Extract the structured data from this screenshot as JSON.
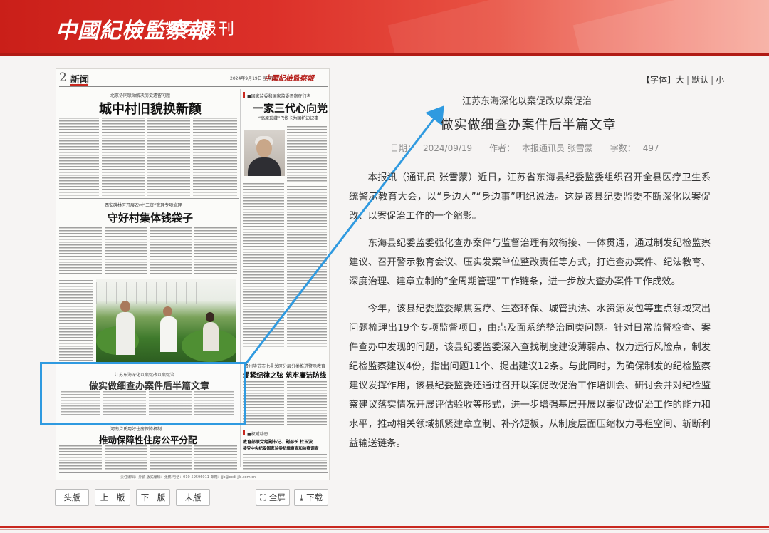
{
  "header": {
    "brand": "中國紀檢監察報",
    "subtitle": "数字报刊"
  },
  "paper": {
    "page_number": "2",
    "section": "新闻",
    "date": "2024年9月19日 星期四",
    "logo": "中國紀檢監察報",
    "story1": {
      "kicker": "北京协同联动解决历史遗留问题",
      "headline": "城中村旧貌换新颜"
    },
    "story2": {
      "kicker": "■国家监委和国家监委督察在行者",
      "headline": "一家三代心向党",
      "subhead": "“高原珍藏”巴依卡为国护边记事"
    },
    "story3": {
      "kicker": "西安碑林区开展农村“三资”管理专项治理",
      "headline": "守好村集体钱袋子"
    },
    "story4": {
      "kicker": "江苏东海深化以案促改以案促治",
      "headline": "做实做细查办案件后半篇文章"
    },
    "story5": {
      "kicker": "贵州毕节市七星关区分层分类推进警示教育",
      "headline": "绷紧纪律之弦 筑牢廉洁防线"
    },
    "story6": {
      "kicker": "河南卢氏用好住房保障机制",
      "headline": "推动保障性住房公平分配"
    },
    "story7": {
      "kicker": "■权威动态",
      "headline_line1": "教育部原党组副书记、副部长 杜玉波",
      "headline_line2": "接受中央纪委国家监委纪律审查和监察调查"
    },
    "footer_line": "责任编辑：孙毓  版式编辑：张鹏  电话：010-59596011  邮箱：jjb@ccdi-jjb.com.cn"
  },
  "toolbar": {
    "font_label": "【字体】",
    "font_large": "大",
    "font_default": "默认",
    "font_small": "小"
  },
  "article": {
    "kicker": "江苏东海深化以案促改以案促治",
    "title": "做实做细查办案件后半篇文章",
    "meta": {
      "date_label": "日期：",
      "date": "2024/09/19",
      "author_label": "作者：",
      "author": "本报通讯员 张雪蒙",
      "words_label": "字数：",
      "words": "497"
    },
    "paragraphs": [
      "本报讯（通讯员 张雪蒙）近日，江苏省东海县纪委监委组织召开全县医疗卫生系统警示教育大会，以“身边人”“身边事”明纪说法。这是该县纪委监委不断深化以案促改、以案促治工作的一个缩影。",
      "东海县纪委监委强化查办案件与监督治理有效衔接、一体贯通，通过制发纪检监察建议、召开警示教育会议、压实发案单位整改责任等方式，打造查办案件、纪法教育、深度治理、建章立制的“全周期管理”工作链条，进一步放大查办案件工作成效。",
      "今年，该县纪委监委聚焦医疗、生态环保、城管执法、水资源发包等重点领域突出问题梳理出19个专项监督项目，由点及面系统整治同类问题。针对日常监督检查、案件查办中发现的问题，该县纪委监委深入查找制度建设薄弱点、权力运行风险点，制发纪检监察建议4份，指出问题11个、提出建议12条。与此同时，为确保制发的纪检监察建议发挥作用，该县纪委监委还通过召开以案促改促治工作培训会、研讨会并对纪检监察建议落实情况开展评估验收等形式，进一步增强基层开展以案促改促治工作的能力和水平，推动相关领域抓紧建章立制、补齐短板，从制度层面压缩权力寻租空间、斩断利益输送链条。"
    ]
  },
  "nav": {
    "first_page": "头版",
    "prev_page": "上一版",
    "next_page": "下一版",
    "last_page": "末版",
    "fullscreen": "全屏",
    "download": "下载"
  },
  "colors": {
    "brand_red": "#c8281f",
    "highlight_blue": "#2f9ae0"
  }
}
